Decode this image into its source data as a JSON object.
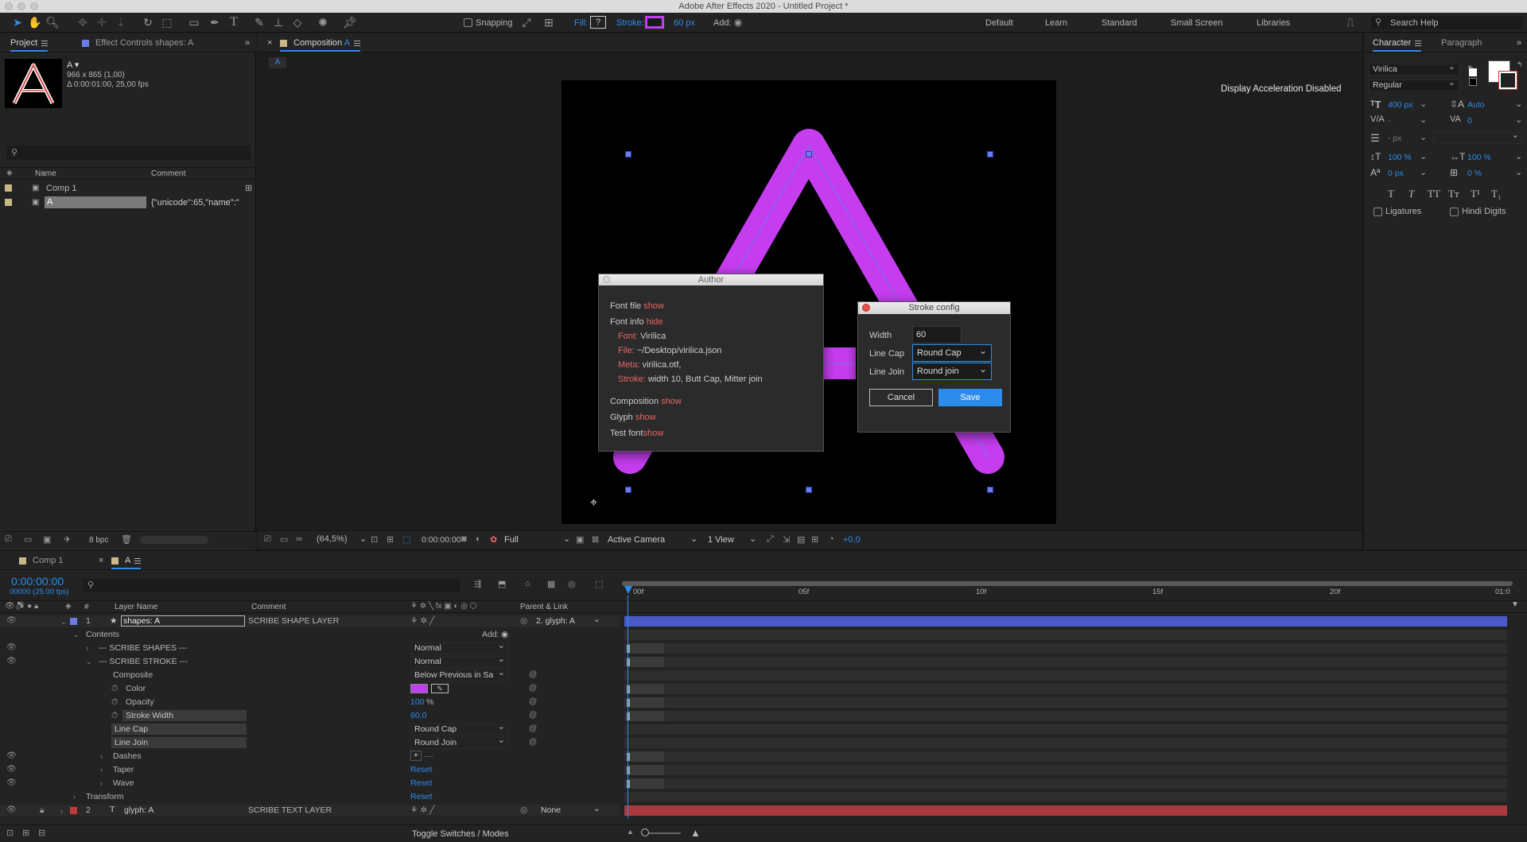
{
  "app": {
    "window_title": "Adobe After Effects 2020 - Untitled Project *"
  },
  "toolbar": {
    "snapping_label": "Snapping",
    "fill_label": "Fill:",
    "fill_value": "?",
    "stroke_label": "Stroke:",
    "stroke_color": "#c040f0",
    "stroke_width": "60 px",
    "add_label": "Add:",
    "workspaces": [
      "Default",
      "Learn",
      "Standard",
      "Small Screen",
      "Libraries"
    ],
    "search_placeholder": "Search Help"
  },
  "project_panel": {
    "tab_project": "Project",
    "tab_effect_controls": "Effect Controls shapes: A",
    "selected_name": "A ▾",
    "selected_size": "966 x 865 (1,00)",
    "selected_duration": "Δ 0:00:01:00, 25,00 fps",
    "search_placeholder": "ρ̶",
    "col_name": "Name",
    "col_comment": "Comment",
    "items": [
      {
        "name": "Comp 1",
        "comment": ""
      },
      {
        "name": "A",
        "comment": "{\"unicode\":65,\"name\":\""
      }
    ],
    "bpc": "8 bpc"
  },
  "composition_panel": {
    "tab_label": "Composition",
    "tab_name": "A",
    "sub_tab": "A",
    "display_accel": "Display Acceleration Disabled",
    "zoom": "(64,5%)",
    "timecode": "0:00:00:00",
    "resolution": "Full",
    "camera": "Active Camera",
    "views": "1 View",
    "exposure": "+0,0"
  },
  "author_dialog": {
    "title": "Author",
    "font_file_label": "Font file",
    "font_file_action": "show",
    "font_info_label": "Font info",
    "font_info_action": "hide",
    "font_key": "Font:",
    "font_val": "Virilica",
    "file_key": "File:",
    "file_val": "~/Desktop/virilica.json",
    "meta_key": "Meta:",
    "meta_val": "virilica.otf,",
    "stroke_key": "Stroke:",
    "stroke_val": "width 10, Butt Cap, Mitter join",
    "composition_label": "Composition",
    "composition_action": "show",
    "glyph_label": "Glyph",
    "glyph_action": "show",
    "test_label": "Test font",
    "test_action": "show"
  },
  "stroke_dialog": {
    "title": "Stroke config",
    "width_label": "Width",
    "width_value": "60",
    "line_cap_label": "Line Cap",
    "line_cap_value": "Round Cap",
    "line_join_label": "Line Join",
    "line_join_value": "Round join",
    "cancel": "Cancel",
    "save": "Save"
  },
  "character_panel": {
    "tab_character": "Character",
    "tab_paragraph": "Paragraph",
    "font": "Virilica",
    "style": "Regular",
    "size": "400 px",
    "leading": "Auto",
    "kerning": "-",
    "tracking": "0",
    "stroke_width": "- px",
    "vscale": "100 %",
    "hscale": "100 %",
    "baseline": "0 px",
    "tsume": "0 %",
    "ligatures": "Ligatures",
    "hindi_digits": "Hindi Digits"
  },
  "timeline": {
    "tab_comp1": "Comp 1",
    "tab_a": "A",
    "timecode": "0:00:00:00",
    "frames": "00000 (25.00 fps)",
    "col_num": "#",
    "col_layer_name": "Layer Name",
    "col_comment": "Comment",
    "col_parent": "Parent & Link",
    "ruler": [
      "00f",
      "05f",
      "10f",
      "15f",
      "20f",
      "01:0"
    ],
    "layer1": {
      "num": "1",
      "name": "shapes: A",
      "comment": "SCRIBE SHAPE LAYER",
      "parent": "2. glyph: A",
      "color": "#6b7be8"
    },
    "contents": "Contents",
    "add": "Add:",
    "scribe_shapes": "--- SCRIBE SHAPES ---",
    "scribe_shapes_mode": "Normal",
    "scribe_stroke": "--- SCRIBE STROKE ---",
    "scribe_stroke_mode": "Normal",
    "composite": "Composite",
    "composite_value": "Below Previous in Sa",
    "color": "Color",
    "color_value": "#c040f0",
    "opacity": "Opacity",
    "opacity_value": "100",
    "opacity_unit": "%",
    "stroke_width": "Stroke Width",
    "stroke_width_value": "60,0",
    "line_cap": "Line Cap",
    "line_cap_value": "Round Cap",
    "line_join": "Line Join",
    "line_join_value": "Round Join",
    "dashes": "Dashes",
    "taper": "Taper",
    "taper_value": "Reset",
    "wave": "Wave",
    "wave_value": "Reset",
    "transform": "Transform",
    "transform_value": "Reset",
    "layer2": {
      "num": "2",
      "name": "glyph: A",
      "comment": "SCRIBE TEXT LAYER",
      "parent": "None",
      "color": "#c43a3a"
    },
    "toggle_switches": "Toggle Switches / Modes"
  }
}
